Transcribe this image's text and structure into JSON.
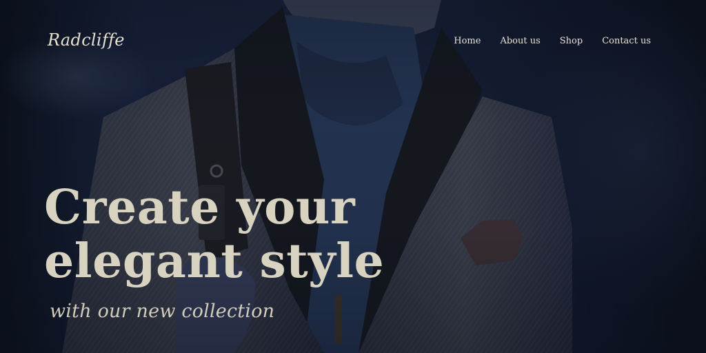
{
  "header": {
    "logo_text": "Radcliffe",
    "nav": [
      {
        "label": "Home"
      },
      {
        "label": "About us"
      },
      {
        "label": "Shop"
      },
      {
        "label": "Contact us"
      }
    ]
  },
  "hero": {
    "headline_line1": "Create your",
    "headline_line2": "elegant style",
    "subheadline": "with our new collection"
  },
  "colors": {
    "background": "#0e1422",
    "headline_text": "#d8d2c1",
    "nav_text": "#e9e4d8"
  }
}
